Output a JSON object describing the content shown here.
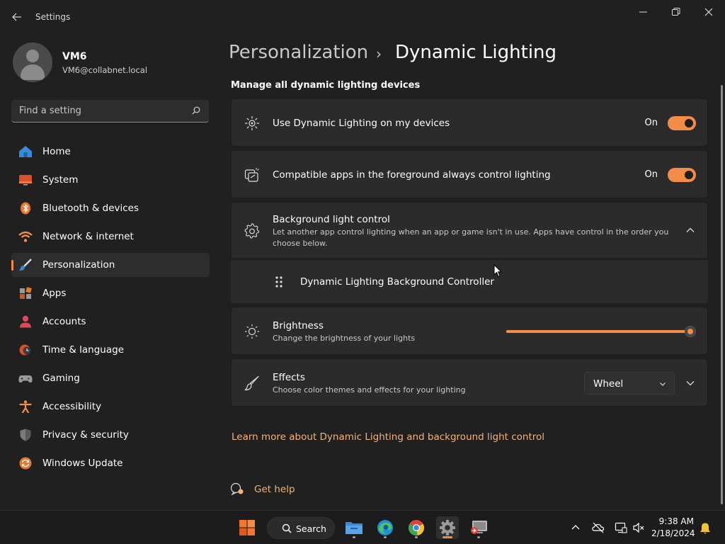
{
  "window": {
    "title": "Settings",
    "controls": {
      "minimize": "—",
      "maximize": "❐",
      "close": "✕"
    }
  },
  "user": {
    "name": "VM6",
    "email": "VM6@collabnet.local"
  },
  "search": {
    "placeholder": "Find a setting"
  },
  "sidebar": {
    "items": [
      {
        "label": "Home",
        "icon": "home-icon"
      },
      {
        "label": "System",
        "icon": "system-icon"
      },
      {
        "label": "Bluetooth & devices",
        "icon": "bluetooth-icon"
      },
      {
        "label": "Network & internet",
        "icon": "wifi-icon"
      },
      {
        "label": "Personalization",
        "icon": "brush-icon",
        "active": true
      },
      {
        "label": "Apps",
        "icon": "apps-icon"
      },
      {
        "label": "Accounts",
        "icon": "accounts-icon"
      },
      {
        "label": "Time & language",
        "icon": "clock-globe-icon"
      },
      {
        "label": "Gaming",
        "icon": "gamepad-icon"
      },
      {
        "label": "Accessibility",
        "icon": "accessibility-icon"
      },
      {
        "label": "Privacy & security",
        "icon": "shield-icon"
      },
      {
        "label": "Windows Update",
        "icon": "update-icon"
      }
    ]
  },
  "breadcrumb": {
    "parent": "Personalization",
    "separator": "›",
    "current": "Dynamic Lighting"
  },
  "main": {
    "section_heading": "Manage all dynamic lighting devices",
    "use_dynamic": {
      "title": "Use Dynamic Lighting on my devices",
      "state": "On",
      "on": true
    },
    "compatible_apps": {
      "title": "Compatible apps in the foreground always control lighting",
      "state": "On",
      "on": true
    },
    "background_control": {
      "title": "Background light control",
      "subtitle": "Let another app control lighting when an app or game isn't in use. Apps have control in the order you choose below.",
      "expanded": true,
      "controller": "Dynamic Lighting Background Controller"
    },
    "brightness": {
      "title": "Brightness",
      "subtitle": "Change the brightness of your lights",
      "value": 100
    },
    "effects": {
      "title": "Effects",
      "subtitle": "Choose color themes and effects for your lighting",
      "selected": "Wheel"
    },
    "learn_more": "Learn more about Dynamic Lighting and background light control",
    "get_help": "Get help"
  },
  "taskbar": {
    "search_label": "Search",
    "apps": [
      "start-icon",
      "file-explorer-icon",
      "edge-icon",
      "chrome-icon",
      "settings-icon",
      "remote-desktop-icon"
    ],
    "clock": {
      "time": "9:38 AM",
      "date": "2/18/2024"
    }
  },
  "colors": {
    "accent": "#f28c46",
    "link": "#f2b27c",
    "card": "#2b2b2b",
    "background": "#202020"
  }
}
